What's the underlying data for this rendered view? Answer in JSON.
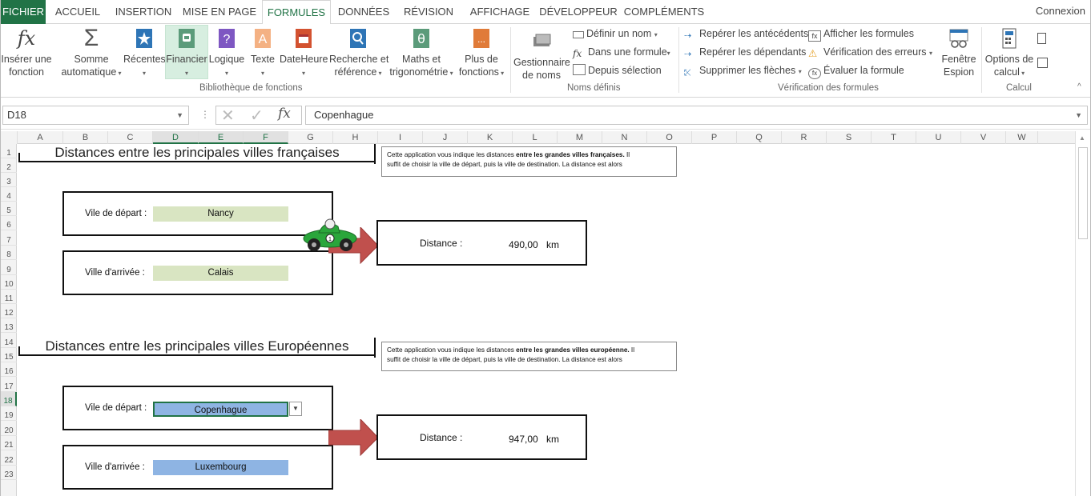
{
  "tabs": [
    "FICHIER",
    "ACCUEIL",
    "INSERTION",
    "MISE EN PAGE",
    "FORMULES",
    "DONNÉES",
    "RÉVISION",
    "AFFICHAGE",
    "DÉVELOPPEUR",
    "COMPLÉMENTS"
  ],
  "account": "Connexion",
  "ribbon": {
    "insert_fn": [
      "Insérer une",
      "fonction"
    ],
    "autosum": [
      "Somme",
      "automatique"
    ],
    "recent": "Récentes",
    "financial": "Financier",
    "logical": "Logique",
    "text": "Texte",
    "datetime": "DateHeure",
    "lookup": [
      "Recherche et",
      "référence"
    ],
    "math": [
      "Maths et",
      "trigonométrie"
    ],
    "more": [
      "Plus de",
      "fonctions"
    ],
    "group_lib": "Bibliothèque de fonctions",
    "name_mgr": [
      "Gestionnaire",
      "de noms"
    ],
    "define_name": "Définir un nom",
    "use_in_formula": "Dans une formule",
    "from_selection": "Depuis sélection",
    "group_names": "Noms définis",
    "trace_prec": "Repérer les antécédents",
    "trace_dep": "Repérer les dépendants",
    "remove_arrows": "Supprimer les flèches",
    "show_formulas": "Afficher les formules",
    "error_check": "Vérification des erreurs",
    "eval_formula": "Évaluer la formule",
    "group_audit": "Vérification des formules",
    "watch": [
      "Fenêtre",
      "Espion"
    ],
    "calc_options": [
      "Options de",
      "calcul"
    ],
    "group_calc": "Calcul"
  },
  "formula_bar": {
    "name_box": "D18",
    "content": "Copenhague"
  },
  "columns": [
    "A",
    "B",
    "C",
    "D",
    "E",
    "F",
    "G",
    "H",
    "I",
    "J",
    "K",
    "L",
    "M",
    "N",
    "O",
    "P",
    "Q",
    "R",
    "S",
    "T",
    "U",
    "V",
    "W"
  ],
  "rows": [
    "1",
    "2",
    "3",
    "4",
    "5",
    "6",
    "7",
    "8",
    "9",
    "10",
    "11",
    "12",
    "13",
    "14",
    "15",
    "16",
    "17",
    "18",
    "19",
    "20",
    "21",
    "22",
    "23"
  ],
  "section1": {
    "title": "Distances entre les principales villes françaises",
    "note_line1_a": "Cette application vous indique les distances ",
    "note_line1_b": "entre les grandes villes françaises.",
    "note_line1_c": " Il",
    "note_line2": "suffit de choisir la ville de départ, puis la ville de destination. La distance est alors",
    "depart_label": "Vile de départ :",
    "depart_value": "Nancy",
    "arrival_label": "Ville d'arrivée :",
    "arrival_value": "Calais",
    "distance_label": "Distance   :",
    "distance_value": "490,00",
    "unit": "km"
  },
  "section2": {
    "title": "Distances entre les principales villes Européennes",
    "note_line1_a": "Cette application vous indique les distances ",
    "note_line1_b": "entre les grandes villes européenne.",
    "note_line1_c": " Il",
    "note_line2": "suffit de choisir la ville de départ, puis la ville de destination. La distance est alors",
    "depart_label": "Vile de départ :",
    "depart_value": "Copenhague",
    "arrival_label": "Ville d'arrivée :",
    "arrival_value": "Luxembourg",
    "distance_label": "Distance   :",
    "distance_value": "947,00",
    "unit": "km"
  },
  "colors": {
    "excel_green": "#217346",
    "input_green": "#d9e5c2",
    "input_blue": "#8eb4e3",
    "arrow_red": "#c0504d"
  }
}
